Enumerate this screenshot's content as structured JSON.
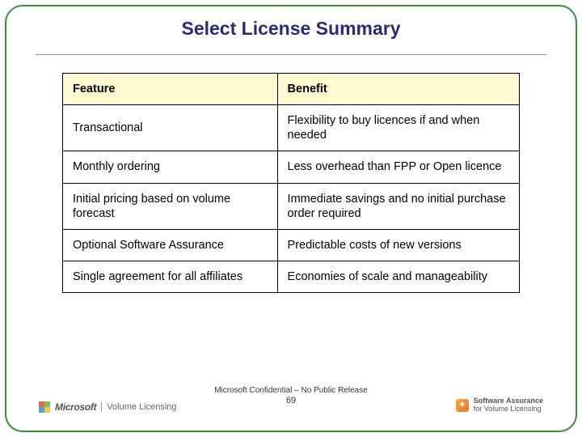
{
  "title": "Select License Summary",
  "table": {
    "headers": {
      "feature": "Feature",
      "benefit": "Benefit"
    },
    "rows": [
      {
        "feature": "Transactional",
        "benefit": "Flexibility to buy licences if and when needed"
      },
      {
        "feature": "Monthly ordering",
        "benefit": "Less overhead than FPP or Open licence"
      },
      {
        "feature": "Initial pricing based on volume forecast",
        "benefit": "Immediate savings and no initial purchase order required"
      },
      {
        "feature": "Optional Software Assurance",
        "benefit": "Predictable costs of new versions"
      },
      {
        "feature": "Single agreement for all affiliates",
        "benefit": "Economies of scale and manageability"
      }
    ]
  },
  "footer": {
    "confidential": "Microsoft Confidential – No Public Release",
    "page": "69"
  },
  "branding": {
    "ms": "Microsoft",
    "vl": "Volume Licensing",
    "sa_line1": "Software Assurance",
    "sa_line2": "for Volume Licensing"
  }
}
